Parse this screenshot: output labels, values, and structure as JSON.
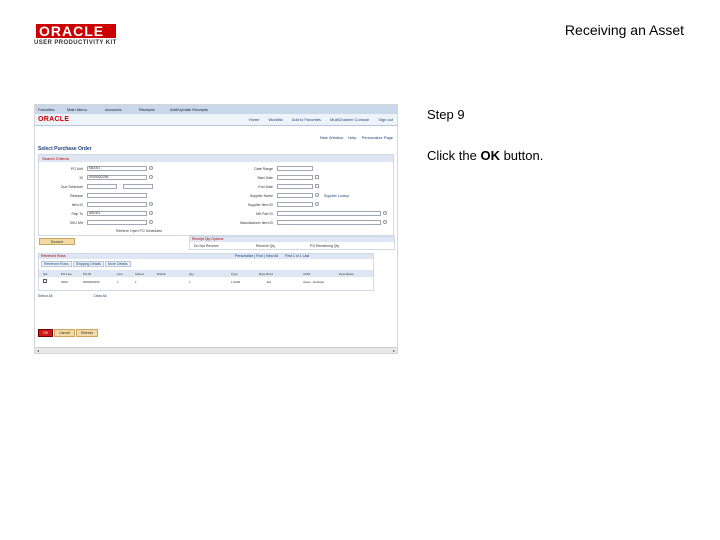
{
  "logo": {
    "word": "ORACLE",
    "sub": "USER PRODUCTIVITY KIT"
  },
  "doc_title": "Receiving an Asset",
  "step": "Step 9",
  "instruction": {
    "before": "Click the ",
    "bold": "OK",
    "after": " button."
  },
  "screenshot": {
    "topbar": [
      "Favorites",
      "Main Menu",
      "Accounts",
      "Receipts",
      "Add/Update Receipts"
    ],
    "app_logo": "ORACLE",
    "nav_links": [
      "Home",
      "Worklist",
      "Add to Favorites",
      "MultiChannel Console",
      "Sign out"
    ],
    "top_links": [
      "New Window",
      "Help",
      "Personalize Page"
    ],
    "page_title": "Select Purchase Order",
    "group_title": "Search Criteria",
    "left_fields": [
      {
        "label": "PO Unit",
        "value": "MD001"
      },
      {
        "label": "ID",
        "value": "0000000256"
      },
      {
        "label": "Due Schedule",
        "value": ""
      },
      {
        "label": "Release",
        "value": ""
      },
      {
        "label": "Item ID",
        "value": ""
      },
      {
        "label": "Ship To",
        "value": "MD001"
      },
      {
        "label": "SKU Mfr",
        "value": ""
      }
    ],
    "right_fields": [
      {
        "label": "Date Range",
        "value": ""
      },
      {
        "label": "Start Date",
        "value": ""
      },
      {
        "label": "End Date",
        "value": ""
      },
      {
        "label": "Supplier Name",
        "value": ""
      },
      {
        "label": "Supplier Item ID",
        "value": ""
      },
      {
        "label": "Mfr Part ID",
        "value": ""
      },
      {
        "label": "Manufacturer Item ID",
        "value": ""
      }
    ],
    "supplier_lookup": "Supplier Lookup",
    "retrieve_checkbox": "Retrieve Open PO Schedules",
    "search_button": "Search",
    "receipt_qty_title": "Receipt Qty Options",
    "radio_options": [
      "Do Not Receive",
      "Receive Qty",
      "PO Remaining Qty"
    ],
    "grid_title": "Retrieved Rows",
    "grid_tabs": [
      "Retrieved Rows",
      "Shipping Details",
      "More Details"
    ],
    "grid_nav": [
      "Personalize",
      "Find",
      "View All",
      "First",
      "1 of 1",
      "Last"
    ],
    "grid_columns": [
      "Sel",
      "PO Line",
      "PO ID",
      "Line",
      "Sched",
      "Distrib",
      "Qty",
      "Type",
      "Rcpt Rcvd",
      "UOM",
      "Description"
    ],
    "grid_row": [
      "0000",
      "0000000256",
      "1",
      "1",
      "",
      "1",
      "1,0000",
      "EA",
      "Asset - Desktop"
    ],
    "select_all": "Select All",
    "clear_all": "Clear All",
    "buttons": [
      "OK",
      "Cancel",
      "Refresh"
    ]
  }
}
